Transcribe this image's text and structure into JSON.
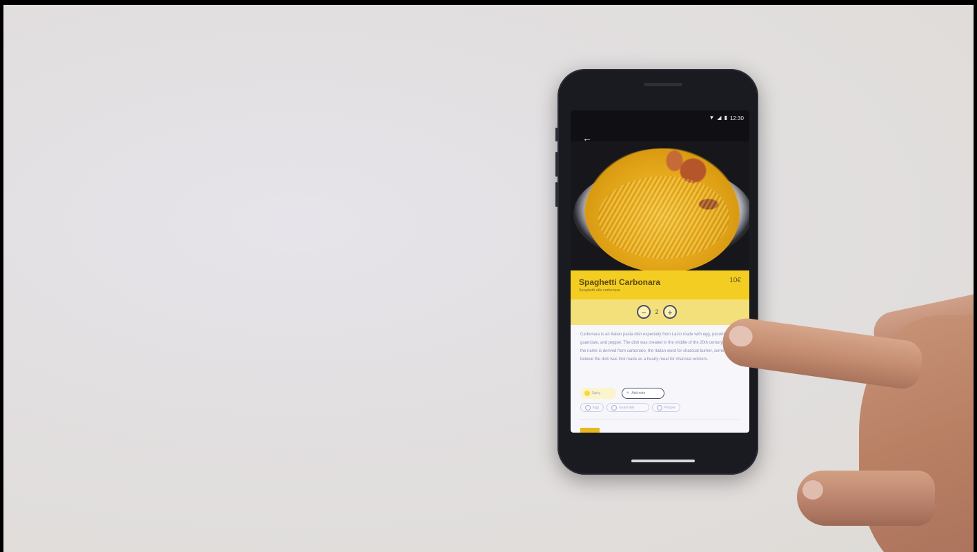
{
  "status_bar": {
    "time": "12:30"
  },
  "dish": {
    "name": "Spaghetti Carbonara",
    "subtitle": "Spaghetti alla carbonara",
    "price": "10€",
    "quantity": "2"
  },
  "description": "Carbonara is an Italian pasta dish especially from Lazio made with egg, pecorino, guanciale, and pepper. The dish was created in the middle of the 20th century. Since the name is derived from carbonaro, the Italian word for charcoal burner, some believe the dish was first made as a hearty meal for charcoal workers.",
  "chips": [
    "Spicy",
    "Add note"
  ],
  "tags": [
    "Egg",
    "Guanciale",
    "Pepper"
  ],
  "colors": {
    "accent": "#f4cd23",
    "accent_light": "#f3e07a",
    "text_dark": "#4b4f6a"
  },
  "icons": {
    "back": "arrow-left-icon",
    "minus": "minus-icon",
    "plus": "plus-icon",
    "wifi": "wifi-icon",
    "signal": "signal-icon",
    "battery": "battery-icon"
  }
}
